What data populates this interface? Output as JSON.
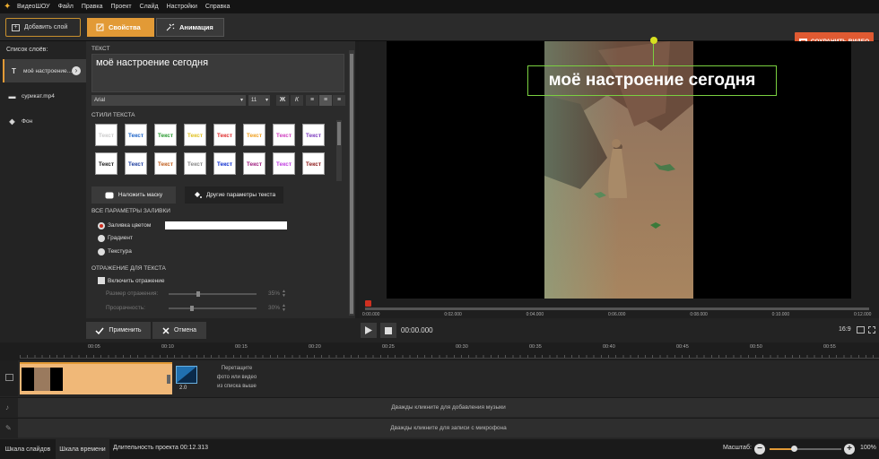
{
  "menu": {
    "app_name": "ВидеоШОУ",
    "items": [
      "Файл",
      "Правка",
      "Проект",
      "Слайд",
      "Настройки",
      "Справка"
    ]
  },
  "toolbar": {
    "add_layer": "Добавить слой",
    "tab_properties": "Свойства",
    "tab_animation": "Анимация",
    "save_video": "СОХРАНИТЬ ВИДЕО"
  },
  "layers": {
    "title": "Список слоёв:",
    "items": [
      {
        "label": "моё настроение...",
        "icon": "text-icon"
      },
      {
        "label": "сурикат.mp4",
        "icon": "video-icon"
      },
      {
        "label": "Фон",
        "icon": "fill-icon"
      }
    ]
  },
  "props": {
    "text_section": "ТЕКСТ",
    "text_value": "моё настроение сегодня",
    "font": "Arial",
    "size": "11",
    "bold_glyph": "Ж",
    "italic_glyph": "К",
    "styles_section": "СТИЛИ ТЕКСТА",
    "style_samples": [
      "Текст",
      "Текст",
      "Текст",
      "Текст",
      "Текст",
      "Текст",
      "Текст",
      "Текст",
      "Текст",
      "Текст",
      "Текст",
      "Текст",
      "Текст",
      "Текст",
      "Текст",
      "Текст"
    ],
    "style_colors": [
      "#cccccc",
      "#1e64c8",
      "#2a9a30",
      "#e0c020",
      "#e03030",
      "#f0a020",
      "#d040c0",
      "#8040c0",
      "#222222",
      "#2040a0",
      "#c06020",
      "#888888",
      "#1030d0",
      "#a02080",
      "#c040e0",
      "#902020"
    ],
    "mask_btn": "Наложить маску",
    "other_btn": "Другие параметры текста",
    "fill_section": "ВСЕ ПАРАМЕТРЫ ЗАЛИВКИ",
    "fill_color": "Заливка цветом",
    "fill_gradient": "Градиент",
    "fill_texture": "Текстура",
    "reflection_section": "ОТРАЖЕНИЕ ДЛЯ ТЕКСТА",
    "reflection_enable": "Включить отражение",
    "reflection_size": "Размер отражения:",
    "reflection_size_val": "35%",
    "reflection_size_level": 0.35,
    "transparency": "Прозрачность:",
    "transparency_val": "30%",
    "transparency_level": 0.3
  },
  "preview": {
    "overlay_text": "моё настроение сегодня",
    "ruler_ticks": [
      "0:00.000",
      "0:02.000",
      "0:04.000",
      "0:06.000",
      "0:08.000",
      "0:10.000",
      "0:12.000"
    ],
    "time": "00:00.000",
    "ratio": "16:9"
  },
  "actions": {
    "apply": "Применить",
    "cancel": "Отмена"
  },
  "timeline": {
    "ticks": [
      "00:05",
      "00:10",
      "00:15",
      "00:20",
      "00:25",
      "00:30",
      "00:35",
      "00:40",
      "00:45",
      "00:50",
      "00:55"
    ],
    "transition_duration": "2.0",
    "drop_hint": [
      "Перетащите",
      "фото или видео",
      "из списка выше"
    ],
    "music_hint": "Дважды кликните для добавления музыки",
    "mic_hint": "Дважды кликните для записи с микрофона"
  },
  "status": {
    "tab_slides": "Шкала слайдов",
    "tab_timeline": "Шкала времени",
    "duration": "Длительность проекта 00:12.313",
    "zoom_label": "Масштаб:",
    "zoom_value": "100%",
    "zoom_level": 0.2
  },
  "colors": {
    "accent": "#e29a36",
    "save": "#e05a32",
    "slide_bg": "#f0b878"
  }
}
